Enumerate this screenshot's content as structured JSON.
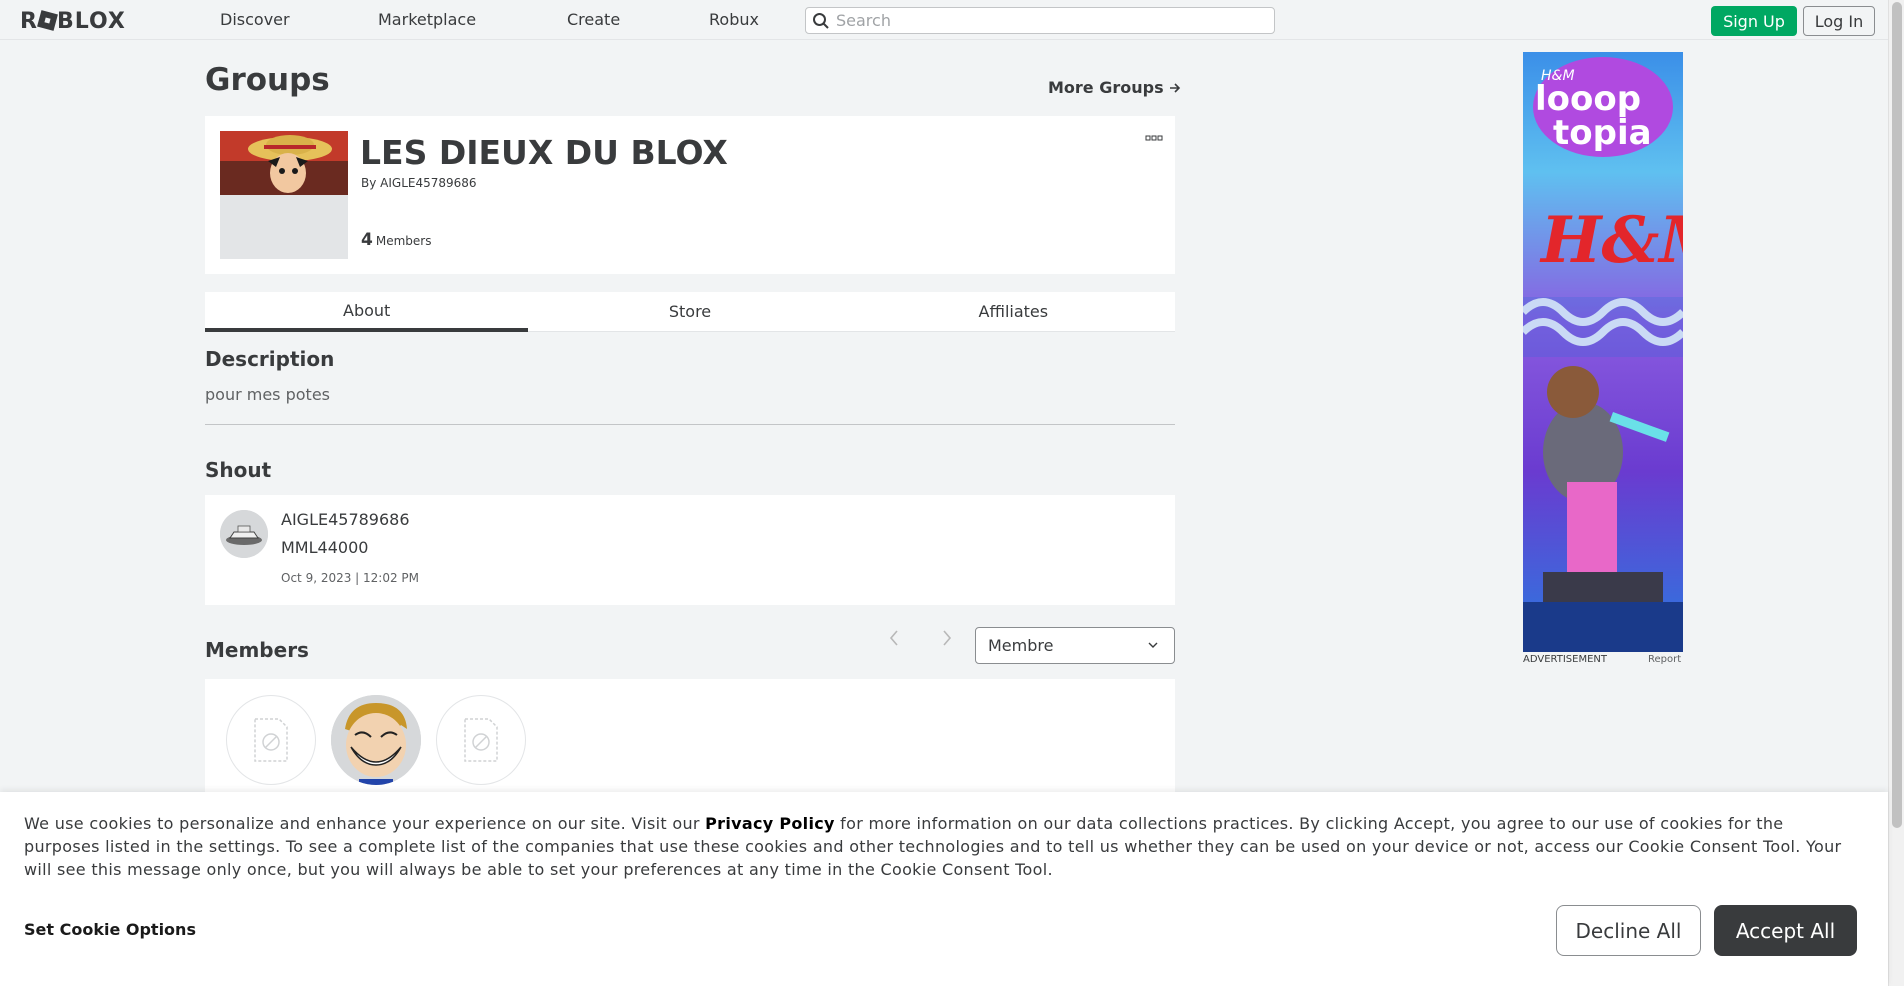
{
  "nav": {
    "logo": "ROBLOX",
    "links": [
      "Discover",
      "Marketplace",
      "Create",
      "Robux"
    ],
    "search_placeholder": "Search",
    "signup": "Sign Up",
    "login": "Log In"
  },
  "page": {
    "title": "Groups",
    "more_groups": "More Groups"
  },
  "group": {
    "name": "LES DIEUX DU BLOX",
    "by_label": "By",
    "owner": "AIGLE45789686",
    "member_count": "4",
    "members_label": "Members",
    "more_icon": "ellipsis-icon"
  },
  "tabs": [
    "About",
    "Store",
    "Affiliates"
  ],
  "about": {
    "description_title": "Description",
    "description": "pour mes potes",
    "shout_title": "Shout",
    "shout": {
      "user": "AIGLE45789686",
      "message": "MML44000",
      "date": "Oct 9, 2023 | 12:02 PM"
    },
    "members_title": "Members",
    "role_selected": "Membre"
  },
  "ad": {
    "label": "ADVERTISEMENT",
    "report": "Report",
    "brand": "H&M",
    "headline_1": "looop",
    "headline_2": "topia"
  },
  "cookie": {
    "text_before": "We use cookies to personalize and enhance your experience on our site. Visit our ",
    "privacy_link": "Privacy Policy",
    "text_after": " for more information on our data collections practices. By clicking Accept, you agree to our use of cookies for the purposes listed in the settings. To see a complete list of the companies that use these cookies and other technologies and to tell us whether they can be used on your device or not, access our Cookie Consent Tool. Your will see this message only once, but you will always be able to set your preferences at any time in the Cookie Consent Tool.",
    "set_options": "Set Cookie Options",
    "decline": "Decline All",
    "accept": "Accept All"
  },
  "colors": {
    "signup_green": "#00a862",
    "accept_dark": "#393b3d",
    "page_bg": "#f2f4f5"
  }
}
